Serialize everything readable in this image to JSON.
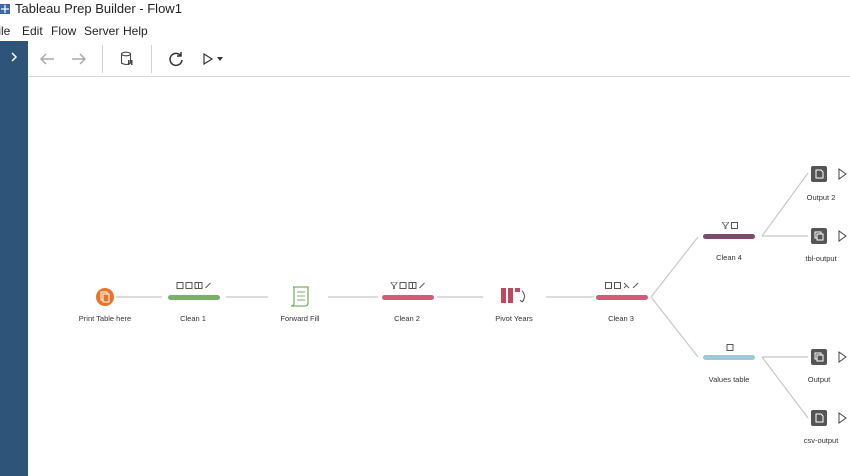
{
  "window": {
    "title": "Tableau Prep Builder - Flow1"
  },
  "menu": {
    "items": [
      "File",
      "Edit",
      "Flow",
      "Server",
      "Help"
    ]
  },
  "toolbar": {
    "back_icon": "back-arrow-icon",
    "forward_icon": "forward-arrow-icon",
    "data_icon": "data-pause-icon",
    "refresh_icon": "refresh-icon",
    "run_icon": "run-icon"
  },
  "flow": {
    "nodes": [
      {
        "id": "input",
        "label": "Print Table here",
        "type": "input",
        "color": "#e8742a"
      },
      {
        "id": "clean1",
        "label": "Clean 1",
        "type": "clean",
        "color": "#7ab06a"
      },
      {
        "id": "ffill",
        "label": "Forward Fill",
        "type": "script",
        "color": "#7ab06a"
      },
      {
        "id": "clean2",
        "label": "Clean 2",
        "type": "clean",
        "color": "#d65a78"
      },
      {
        "id": "pivot",
        "label": "Pivot Years",
        "type": "pivot",
        "color": "#c0495e"
      },
      {
        "id": "clean3",
        "label": "Clean 3",
        "type": "clean",
        "color": "#d65a78"
      },
      {
        "id": "clean4",
        "label": "Clean 4",
        "type": "clean",
        "color": "#7d4a6e"
      },
      {
        "id": "values",
        "label": "Values table",
        "type": "clean",
        "color": "#9ccad6"
      },
      {
        "id": "out2",
        "label": "Output 2",
        "type": "output-file"
      },
      {
        "id": "tbl",
        "label": "tbl-output",
        "type": "output-db"
      },
      {
        "id": "out",
        "label": "Output",
        "type": "output-db"
      },
      {
        "id": "csv",
        "label": "csv-output",
        "type": "output-file"
      }
    ]
  },
  "colors": {
    "rail": "#2e5479",
    "edge": "#c8c8c8",
    "output_icon": "#555555"
  }
}
